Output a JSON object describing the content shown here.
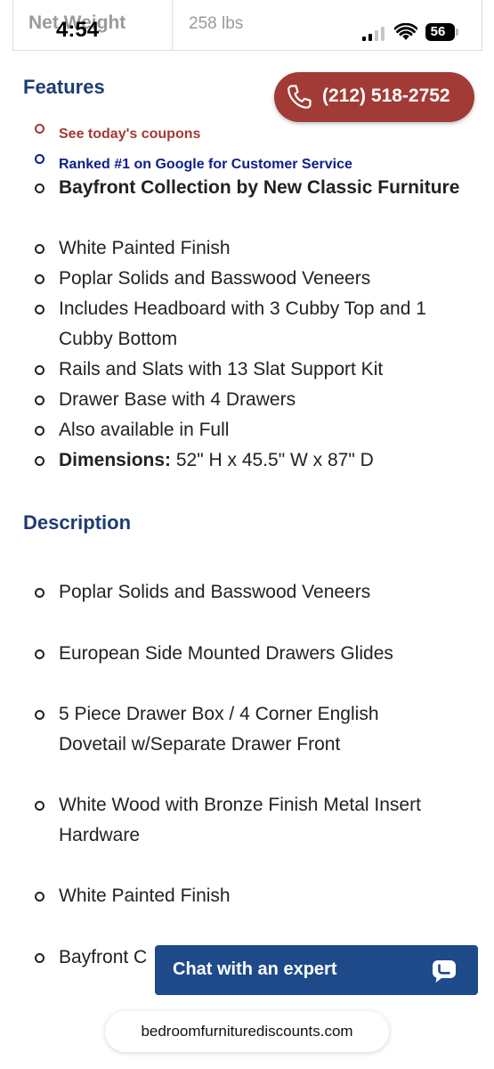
{
  "spec_row": {
    "label": "Net Weight",
    "value": "258 lbs"
  },
  "status_bar": {
    "time": "4:54",
    "battery": "56"
  },
  "call_button": {
    "label": "(212) 518-2752"
  },
  "features": {
    "heading": "Features",
    "promo_coupons": "See today's coupons",
    "promo_ranked": "Ranked #1 on Google for Customer Service",
    "items": [
      "Bayfront Collection by New Classic Furniture",
      "White Painted Finish",
      "Poplar Solids and Basswood Veneers",
      "Includes Headboard with 3 Cubby Top and 1 Cubby Bottom",
      "Rails and Slats with 13 Slat Support Kit",
      "Drawer Base with 4 Drawers",
      "Also available in Full"
    ],
    "dimensions_label": "Dimensions:",
    "dimensions_value": "52\" H x 45.5\" W x 87\" D"
  },
  "description": {
    "heading": "Description",
    "items": [
      "Poplar Solids and Basswood Veneers",
      "European Side Mounted Drawers Glides",
      "5 Piece Drawer Box /  4 Corner English Dovetail w/Separate Drawer Front",
      "White Wood with Bronze Finish Metal Insert Hardware",
      "White Painted Finish",
      "Bayfront C"
    ]
  },
  "chat": {
    "label": "Chat with an expert",
    "icon": "chat-bubble-icon"
  },
  "browser": {
    "url": "bedroomfurniturediscounts.com"
  },
  "colors": {
    "heading": "#1e3c72",
    "accent_red": "#a23a35",
    "link_blue": "#0b1f8a",
    "chat_bg": "#1e4a8a"
  }
}
